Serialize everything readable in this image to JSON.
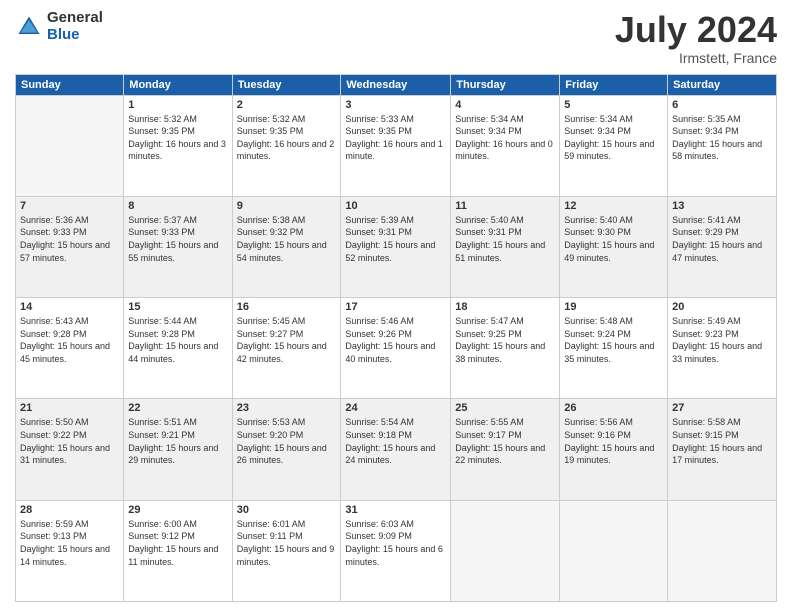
{
  "header": {
    "logo_general": "General",
    "logo_blue": "Blue",
    "month_title": "July 2024",
    "location": "Irmstett, France"
  },
  "weekdays": [
    "Sunday",
    "Monday",
    "Tuesday",
    "Wednesday",
    "Thursday",
    "Friday",
    "Saturday"
  ],
  "weeks": [
    [
      {
        "day": "",
        "sunrise": "",
        "sunset": "",
        "daylight": ""
      },
      {
        "day": "1",
        "sunrise": "Sunrise: 5:32 AM",
        "sunset": "Sunset: 9:35 PM",
        "daylight": "Daylight: 16 hours and 3 minutes."
      },
      {
        "day": "2",
        "sunrise": "Sunrise: 5:32 AM",
        "sunset": "Sunset: 9:35 PM",
        "daylight": "Daylight: 16 hours and 2 minutes."
      },
      {
        "day": "3",
        "sunrise": "Sunrise: 5:33 AM",
        "sunset": "Sunset: 9:35 PM",
        "daylight": "Daylight: 16 hours and 1 minute."
      },
      {
        "day": "4",
        "sunrise": "Sunrise: 5:34 AM",
        "sunset": "Sunset: 9:34 PM",
        "daylight": "Daylight: 16 hours and 0 minutes."
      },
      {
        "day": "5",
        "sunrise": "Sunrise: 5:34 AM",
        "sunset": "Sunset: 9:34 PM",
        "daylight": "Daylight: 15 hours and 59 minutes."
      },
      {
        "day": "6",
        "sunrise": "Sunrise: 5:35 AM",
        "sunset": "Sunset: 9:34 PM",
        "daylight": "Daylight: 15 hours and 58 minutes."
      }
    ],
    [
      {
        "day": "7",
        "sunrise": "Sunrise: 5:36 AM",
        "sunset": "Sunset: 9:33 PM",
        "daylight": "Daylight: 15 hours and 57 minutes."
      },
      {
        "day": "8",
        "sunrise": "Sunrise: 5:37 AM",
        "sunset": "Sunset: 9:33 PM",
        "daylight": "Daylight: 15 hours and 55 minutes."
      },
      {
        "day": "9",
        "sunrise": "Sunrise: 5:38 AM",
        "sunset": "Sunset: 9:32 PM",
        "daylight": "Daylight: 15 hours and 54 minutes."
      },
      {
        "day": "10",
        "sunrise": "Sunrise: 5:39 AM",
        "sunset": "Sunset: 9:31 PM",
        "daylight": "Daylight: 15 hours and 52 minutes."
      },
      {
        "day": "11",
        "sunrise": "Sunrise: 5:40 AM",
        "sunset": "Sunset: 9:31 PM",
        "daylight": "Daylight: 15 hours and 51 minutes."
      },
      {
        "day": "12",
        "sunrise": "Sunrise: 5:40 AM",
        "sunset": "Sunset: 9:30 PM",
        "daylight": "Daylight: 15 hours and 49 minutes."
      },
      {
        "day": "13",
        "sunrise": "Sunrise: 5:41 AM",
        "sunset": "Sunset: 9:29 PM",
        "daylight": "Daylight: 15 hours and 47 minutes."
      }
    ],
    [
      {
        "day": "14",
        "sunrise": "Sunrise: 5:43 AM",
        "sunset": "Sunset: 9:28 PM",
        "daylight": "Daylight: 15 hours and 45 minutes."
      },
      {
        "day": "15",
        "sunrise": "Sunrise: 5:44 AM",
        "sunset": "Sunset: 9:28 PM",
        "daylight": "Daylight: 15 hours and 44 minutes."
      },
      {
        "day": "16",
        "sunrise": "Sunrise: 5:45 AM",
        "sunset": "Sunset: 9:27 PM",
        "daylight": "Daylight: 15 hours and 42 minutes."
      },
      {
        "day": "17",
        "sunrise": "Sunrise: 5:46 AM",
        "sunset": "Sunset: 9:26 PM",
        "daylight": "Daylight: 15 hours and 40 minutes."
      },
      {
        "day": "18",
        "sunrise": "Sunrise: 5:47 AM",
        "sunset": "Sunset: 9:25 PM",
        "daylight": "Daylight: 15 hours and 38 minutes."
      },
      {
        "day": "19",
        "sunrise": "Sunrise: 5:48 AM",
        "sunset": "Sunset: 9:24 PM",
        "daylight": "Daylight: 15 hours and 35 minutes."
      },
      {
        "day": "20",
        "sunrise": "Sunrise: 5:49 AM",
        "sunset": "Sunset: 9:23 PM",
        "daylight": "Daylight: 15 hours and 33 minutes."
      }
    ],
    [
      {
        "day": "21",
        "sunrise": "Sunrise: 5:50 AM",
        "sunset": "Sunset: 9:22 PM",
        "daylight": "Daylight: 15 hours and 31 minutes."
      },
      {
        "day": "22",
        "sunrise": "Sunrise: 5:51 AM",
        "sunset": "Sunset: 9:21 PM",
        "daylight": "Daylight: 15 hours and 29 minutes."
      },
      {
        "day": "23",
        "sunrise": "Sunrise: 5:53 AM",
        "sunset": "Sunset: 9:20 PM",
        "daylight": "Daylight: 15 hours and 26 minutes."
      },
      {
        "day": "24",
        "sunrise": "Sunrise: 5:54 AM",
        "sunset": "Sunset: 9:18 PM",
        "daylight": "Daylight: 15 hours and 24 minutes."
      },
      {
        "day": "25",
        "sunrise": "Sunrise: 5:55 AM",
        "sunset": "Sunset: 9:17 PM",
        "daylight": "Daylight: 15 hours and 22 minutes."
      },
      {
        "day": "26",
        "sunrise": "Sunrise: 5:56 AM",
        "sunset": "Sunset: 9:16 PM",
        "daylight": "Daylight: 15 hours and 19 minutes."
      },
      {
        "day": "27",
        "sunrise": "Sunrise: 5:58 AM",
        "sunset": "Sunset: 9:15 PM",
        "daylight": "Daylight: 15 hours and 17 minutes."
      }
    ],
    [
      {
        "day": "28",
        "sunrise": "Sunrise: 5:59 AM",
        "sunset": "Sunset: 9:13 PM",
        "daylight": "Daylight: 15 hours and 14 minutes."
      },
      {
        "day": "29",
        "sunrise": "Sunrise: 6:00 AM",
        "sunset": "Sunset: 9:12 PM",
        "daylight": "Daylight: 15 hours and 11 minutes."
      },
      {
        "day": "30",
        "sunrise": "Sunrise: 6:01 AM",
        "sunset": "Sunset: 9:11 PM",
        "daylight": "Daylight: 15 hours and 9 minutes."
      },
      {
        "day": "31",
        "sunrise": "Sunrise: 6:03 AM",
        "sunset": "Sunset: 9:09 PM",
        "daylight": "Daylight: 15 hours and 6 minutes."
      },
      {
        "day": "",
        "sunrise": "",
        "sunset": "",
        "daylight": ""
      },
      {
        "day": "",
        "sunrise": "",
        "sunset": "",
        "daylight": ""
      },
      {
        "day": "",
        "sunrise": "",
        "sunset": "",
        "daylight": ""
      }
    ]
  ]
}
